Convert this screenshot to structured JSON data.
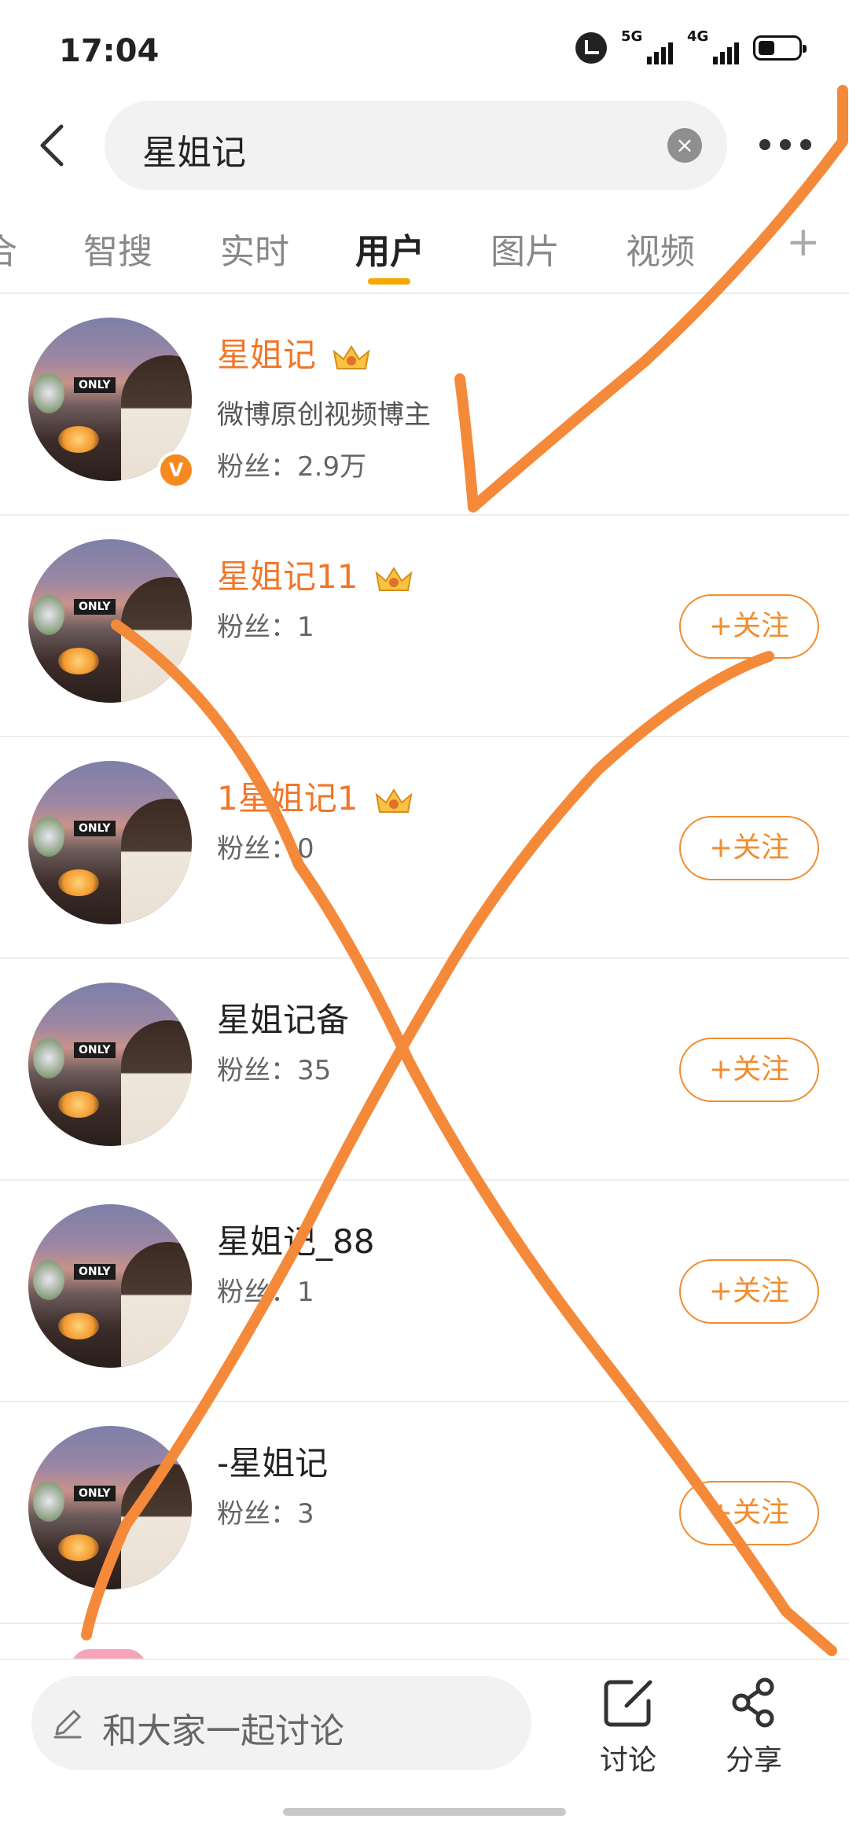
{
  "status_bar": {
    "time": "17:04",
    "sig1": "5G",
    "sig2": "4G"
  },
  "search": {
    "query": "星姐记",
    "clear_symbol": "×"
  },
  "tabs": [
    {
      "label": "合"
    },
    {
      "label": "智搜"
    },
    {
      "label": "实时"
    },
    {
      "label": "用户"
    },
    {
      "label": "图片"
    },
    {
      "label": "视频"
    }
  ],
  "tab_add": "+",
  "users": [
    {
      "name": "星姐记",
      "desc": "微博原创视频博主",
      "fans": "粉丝：2.9万",
      "verified_mark": "V"
    },
    {
      "name": "星姐记11",
      "fans": "粉丝：1",
      "follow": "+关注"
    },
    {
      "name": "1星姐记1",
      "fans": "粉丝：0",
      "follow": "+关注"
    },
    {
      "name": "星姐记备",
      "fans": "粉丝：35",
      "follow": "+关注"
    },
    {
      "name": "星姐记_88",
      "fans": "粉丝：1",
      "follow": "+关注"
    },
    {
      "name": "-星姐记",
      "fans": "粉丝：3",
      "follow": "+关注"
    }
  ],
  "avatar_sign": "ONLY",
  "bottom_bar": {
    "placeholder": "和大家一起讨论",
    "discuss_label": "讨论",
    "share_label": "分享"
  },
  "colors": {
    "accent": "#f08d30",
    "vip_name": "#f0762b",
    "tab_indicator": "#f7a800",
    "annotation": "#f5893a"
  }
}
